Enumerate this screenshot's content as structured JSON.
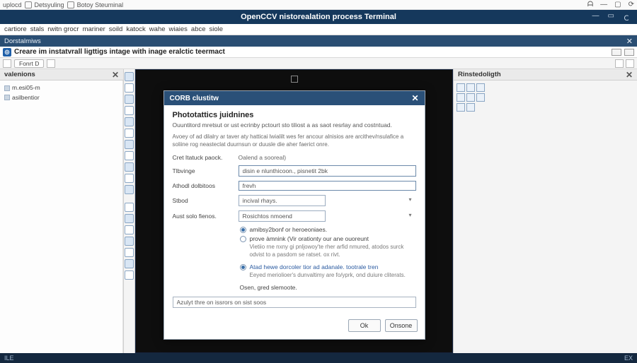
{
  "os_titlebar": {
    "left": [
      "uplocd",
      "Detsyuling",
      "Botoy Steuminal"
    ],
    "right_glyphs": [
      "min",
      "square",
      "reload"
    ]
  },
  "app": {
    "title": "OpenCCV nistorealation process Terminal",
    "window_buttons": {
      "min": "—",
      "max": "▭",
      "close": "Ｃ"
    }
  },
  "menubar": [
    "cartiore",
    "stals",
    "rwitn grocr",
    "mariner",
    "soild",
    "katock",
    "wahe",
    "wiaies",
    "abce",
    "siole"
  ],
  "subbar": {
    "label": "Dorstalmiws",
    "close": "✕"
  },
  "docbar": {
    "logo": "◎",
    "title": "Creare im instatvrall ligttigs intage with inage eralctic teermact"
  },
  "toolbar2": {
    "btn1": "Fonrt D",
    "btn2_icon": "◧"
  },
  "left_panel": {
    "title": "valenions",
    "items": [
      "m.esi05-m",
      "asilbentior"
    ]
  },
  "right_panel": {
    "title": "Rinstedoligth"
  },
  "dialog": {
    "title": "CORB clustitw",
    "heading": "Phototattics juidnines",
    "sub": "Ouuntitord mretsut or ust ecrinby pctourt sto tiliost a as saot resrlay and costntuad.",
    "desc": "Avoey of ad dilalry ar taver aty hatticai lwialilt wes fer ancour alnisios are arcithev/nsulafice a soliine rog neasteclat duurnsun or duusle die aher faerict onre.",
    "rows": {
      "r1_label": "Cret Itatuck paock.",
      "r1_sublabel": "Oalend a sooreal)",
      "r2_label": "Tlbvinge",
      "r2_value": "disin e nlunthicoon., pisnetit 2bk",
      "r3_label": "Athodl dolbitoos",
      "r3_value": "frevh",
      "r4_label": "Stbod",
      "r4_value": "incival rhays.",
      "r5_label": "Aust solo fienos.",
      "r5_value": "Rosichtos nmoend"
    },
    "radios": {
      "opt1": "amibsy2bonf or heroeoniaes.",
      "opt2": "prove àmnink (Vir orationty our ane ouoreunt",
      "help2": "Vietiio rne nxny gi pnljowoy'te rher arfid nmured, atodos surck odvist to a pasdom se ratset. ox rivt.",
      "opt3": "Atad hewe dorcoler tior ad adanale. tootrale tren",
      "help3": "Eeyed meriolioer's dunvaltimy are fo/yprk, ond duiure cliterats."
    },
    "advice": "Osen, gred slemoote.",
    "final_input": "Azulyt thre on issrors on sist soos",
    "ok": "Ok",
    "cancel": "Onsone",
    "close": "✕"
  },
  "statusbar": {
    "left": "ILE",
    "right": "EX"
  }
}
